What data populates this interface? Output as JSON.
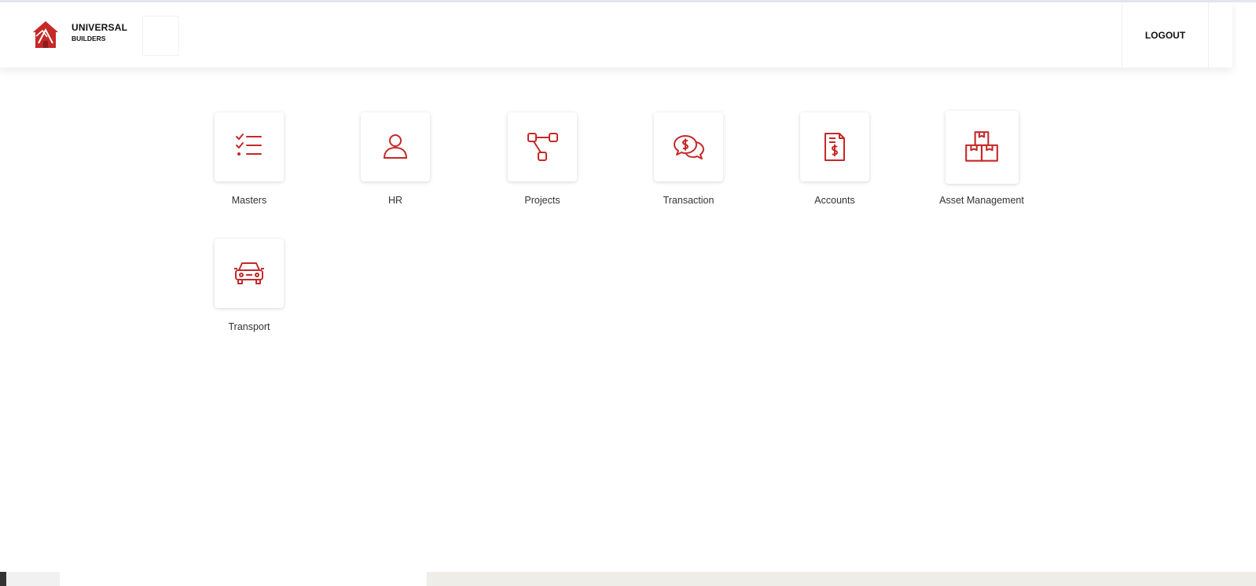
{
  "brand": {
    "name": "UNIVERSAL",
    "subtitle": "BUILDERS",
    "accent_color": "#c62828"
  },
  "header": {
    "logout_label": "LOGOUT"
  },
  "modules": [
    {
      "label": "Masters",
      "icon": "checklist-icon"
    },
    {
      "label": "HR",
      "icon": "user-icon"
    },
    {
      "label": "Projects",
      "icon": "flowchart-icon"
    },
    {
      "label": "Transaction",
      "icon": "chat-dollar-icon"
    },
    {
      "label": "Accounts",
      "icon": "invoice-dollar-icon"
    },
    {
      "label": "Asset Management",
      "icon": "boxes-icon"
    },
    {
      "label": "Transport",
      "icon": "car-icon"
    }
  ]
}
